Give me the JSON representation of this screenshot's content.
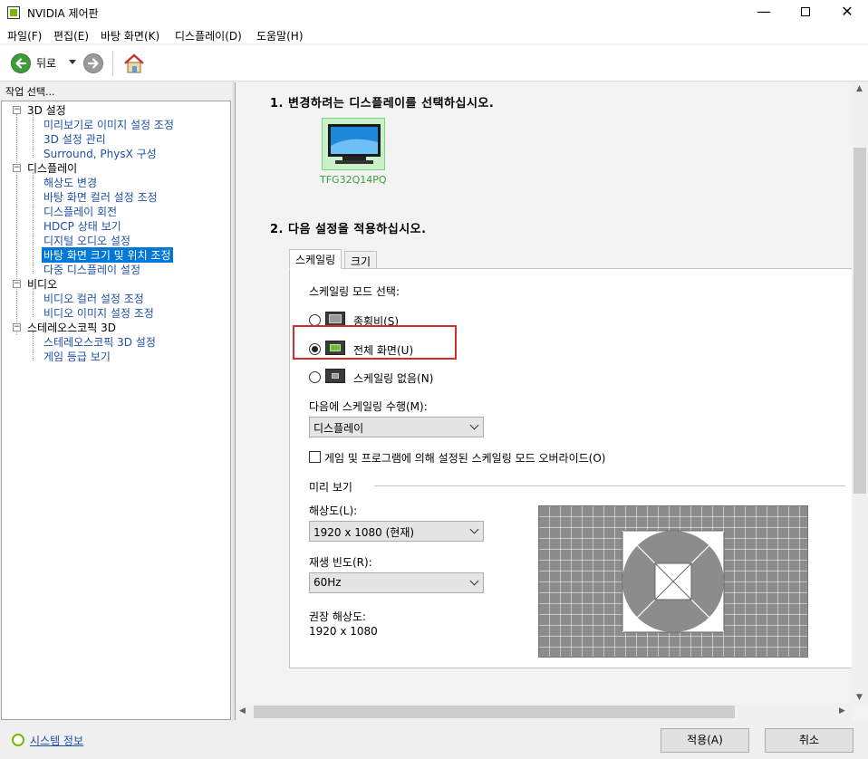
{
  "window": {
    "title": "NVIDIA 제어판",
    "minimize": "—",
    "close": "✕"
  },
  "menu": [
    "파일(F)",
    "편집(E)",
    "바탕 화면(K)",
    "디스플레이(D)",
    "도움말(H)"
  ],
  "toolbar": {
    "back_label": "뒤로"
  },
  "left": {
    "header": "작업 선택...",
    "tree": [
      {
        "label": "3D 설정",
        "children": [
          "미리보기로 이미지 설정 조정",
          "3D 설정 관리",
          "Surround, PhysX 구성"
        ]
      },
      {
        "label": "디스플레이",
        "children": [
          "해상도 변경",
          "바탕 화면 컬러 설정 조정",
          "디스플레이 회전",
          "HDCP 상태 보기",
          "디지털 오디오 설정",
          "바탕 화면 크기 및 위치 조정",
          "다중 디스플레이 설정"
        ]
      },
      {
        "label": "비디오",
        "children": [
          "비디오 컬러 설정 조정",
          "비디오 이미지 설정 조정"
        ]
      },
      {
        "label": "스테레오스코픽 3D",
        "children": [
          "스테레오스코픽 3D 설정",
          "게임 등급 보기"
        ]
      }
    ],
    "selected": "바탕 화면 크기 및 위치 조정"
  },
  "main": {
    "step1": "1. 변경하려는 디스플레이를 선택하십시오.",
    "monitor_name": "TFG32Q14PQ",
    "step2": "2. 다음 설정을 적용하십시오.",
    "tabs": [
      "스케일링",
      "크기"
    ],
    "active_tab": "스케일링",
    "scaling_mode_label": "스케일링 모드 선택:",
    "modes": [
      {
        "label": "종횡비(S)",
        "checked": false
      },
      {
        "label": "전체 화면(U)",
        "checked": true
      },
      {
        "label": "스케일링 없음(N)",
        "checked": false
      }
    ],
    "perform_on_label": "다음에 스케일링 수행(M):",
    "perform_on_value": "디스플레이",
    "override_label": "게임 및 프로그램에 의해 설정된 스케일링 모드 오버라이드(O)",
    "override_checked": false,
    "preview_label": "미리 보기",
    "resolution_label": "해상도(L):",
    "resolution_value": "1920 x 1080 (현재)",
    "refresh_label": "재생 빈도(R):",
    "refresh_value": "60Hz",
    "recommended_label": "권장 해상도:",
    "recommended_value": "1920 x 1080"
  },
  "footer": {
    "sysinfo": "시스템 정보",
    "apply": "적용(A)",
    "cancel": "취소"
  },
  "colors": {
    "selection": "#0078d7",
    "nvidia_green": "#76b900",
    "link": "#1f4fa8",
    "highlight_red": "#d62b2b"
  }
}
